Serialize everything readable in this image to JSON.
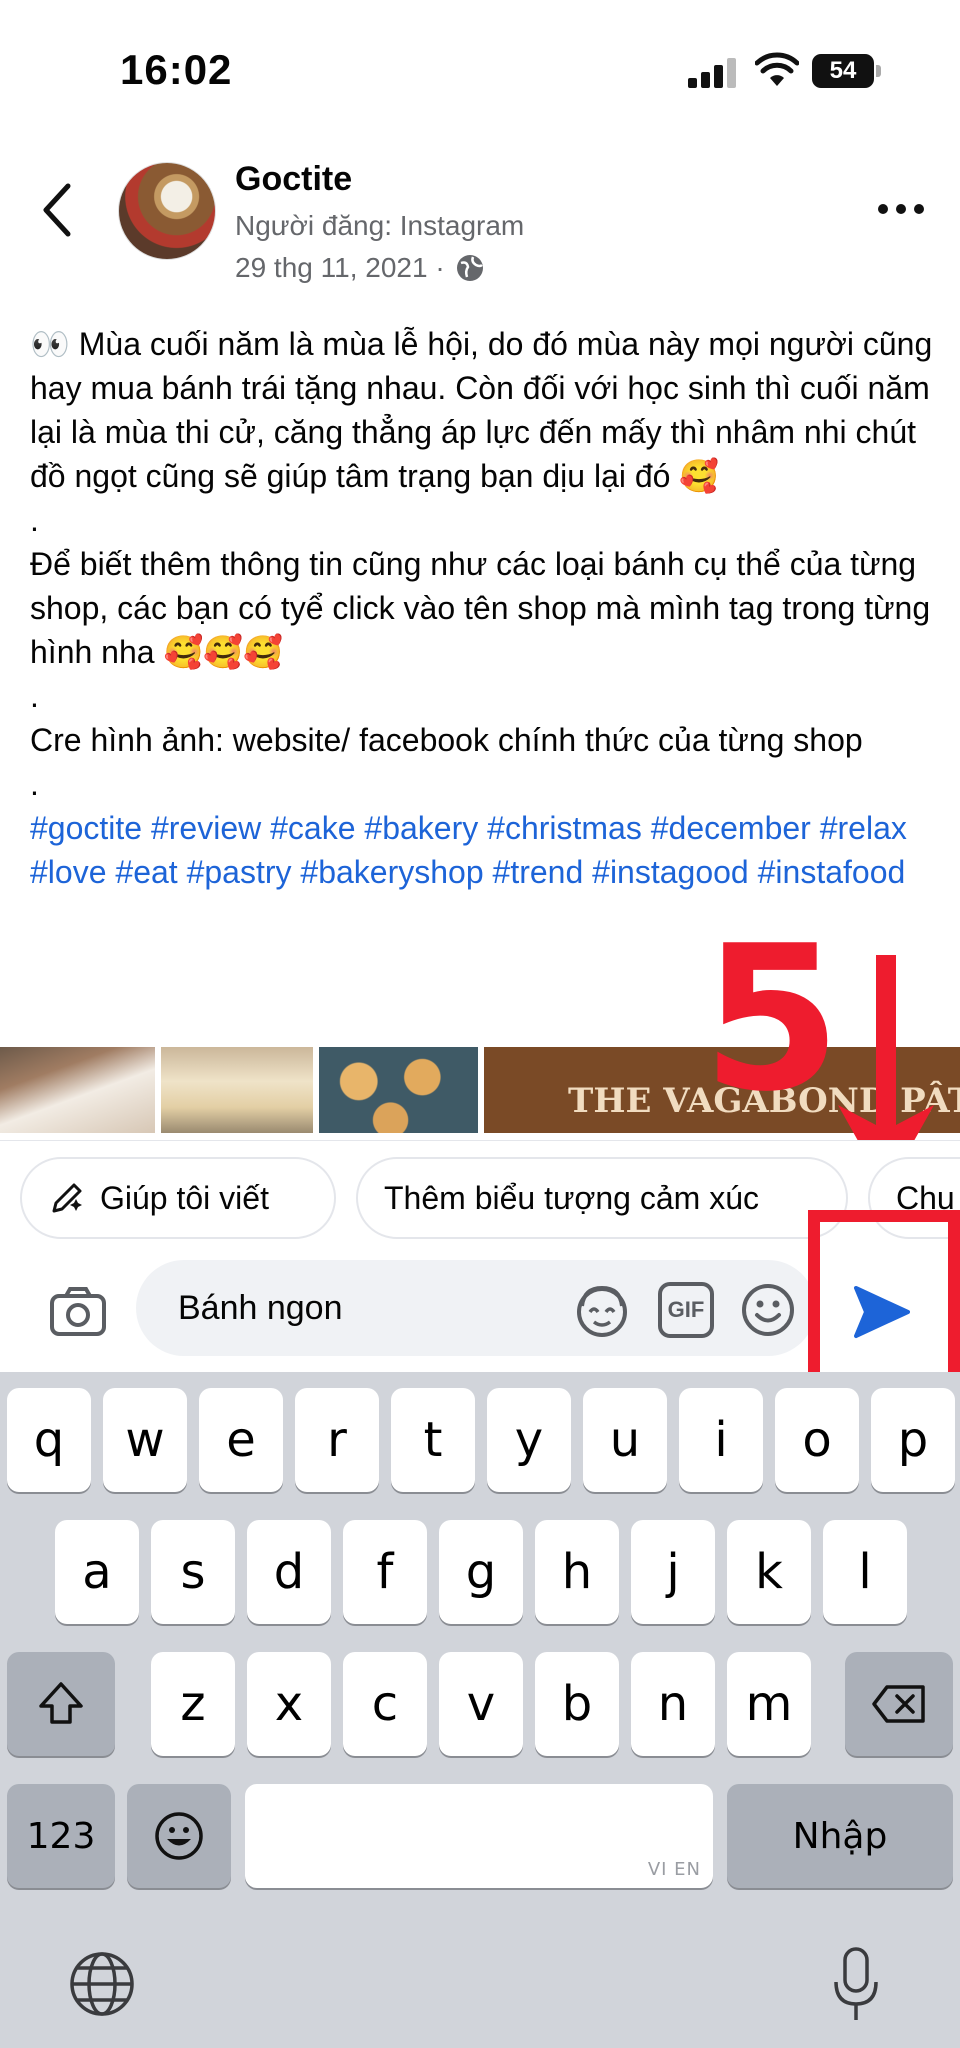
{
  "status_bar": {
    "time": "16:02",
    "battery": "54"
  },
  "post": {
    "author": "Goctite",
    "source": "Người đăng: Instagram",
    "date": "29 thg 11, 2021 ·",
    "body_paragraphs": [
      "👀 Mùa cuối năm là mùa lễ hội, do đó mùa này mọi người cũng hay mua bánh trái tặng nhau. Còn đối với học sinh thì cuối năm lại là mùa thi cử, căng thẳng áp lực đến mấy thì nhâm nhi chút đồ ngọt cũng sẽ giúp tâm trạng bạn dịu lại đó 🥰",
      ".",
      "Để biết thêm thông tin cũng như các loại bánh cụ thể của từng shop, các bạn có tyể click vào tên shop mà mình tag trong từng hình nha 🥰🥰🥰",
      ".",
      "Cre hình ảnh: website/ facebook chính thức của từng shop",
      "."
    ],
    "hashtags": "#goctite #review #cake #bakery #christmas #december #relax #love #eat #pastry #bakeryshop #trend #instagood #instafood"
  },
  "image_strip": {
    "caption": "THE VAGABOND PÂTISSERIE & C"
  },
  "annotation": {
    "step_number": "5"
  },
  "suggestions": [
    {
      "label": "Giúp tôi viết"
    },
    {
      "label": "Thêm biểu tượng cảm xúc"
    },
    {
      "label": "Chu"
    }
  ],
  "composer": {
    "value": "Bánh ngon",
    "gif_label": "GIF"
  },
  "keyboard": {
    "row1": [
      "q",
      "w",
      "e",
      "r",
      "t",
      "y",
      "u",
      "i",
      "o",
      "p"
    ],
    "row2": [
      "a",
      "s",
      "d",
      "f",
      "g",
      "h",
      "j",
      "k",
      "l"
    ],
    "row3": [
      "z",
      "x",
      "c",
      "v",
      "b",
      "n",
      "m"
    ],
    "numbers_label": "123",
    "space_lang": "VI EN",
    "enter_label": "Nhập"
  },
  "colors": {
    "accent": "#1d64d8",
    "annotation_red": "#ee1c2e",
    "keyboard_bg": "#d1d4da"
  }
}
